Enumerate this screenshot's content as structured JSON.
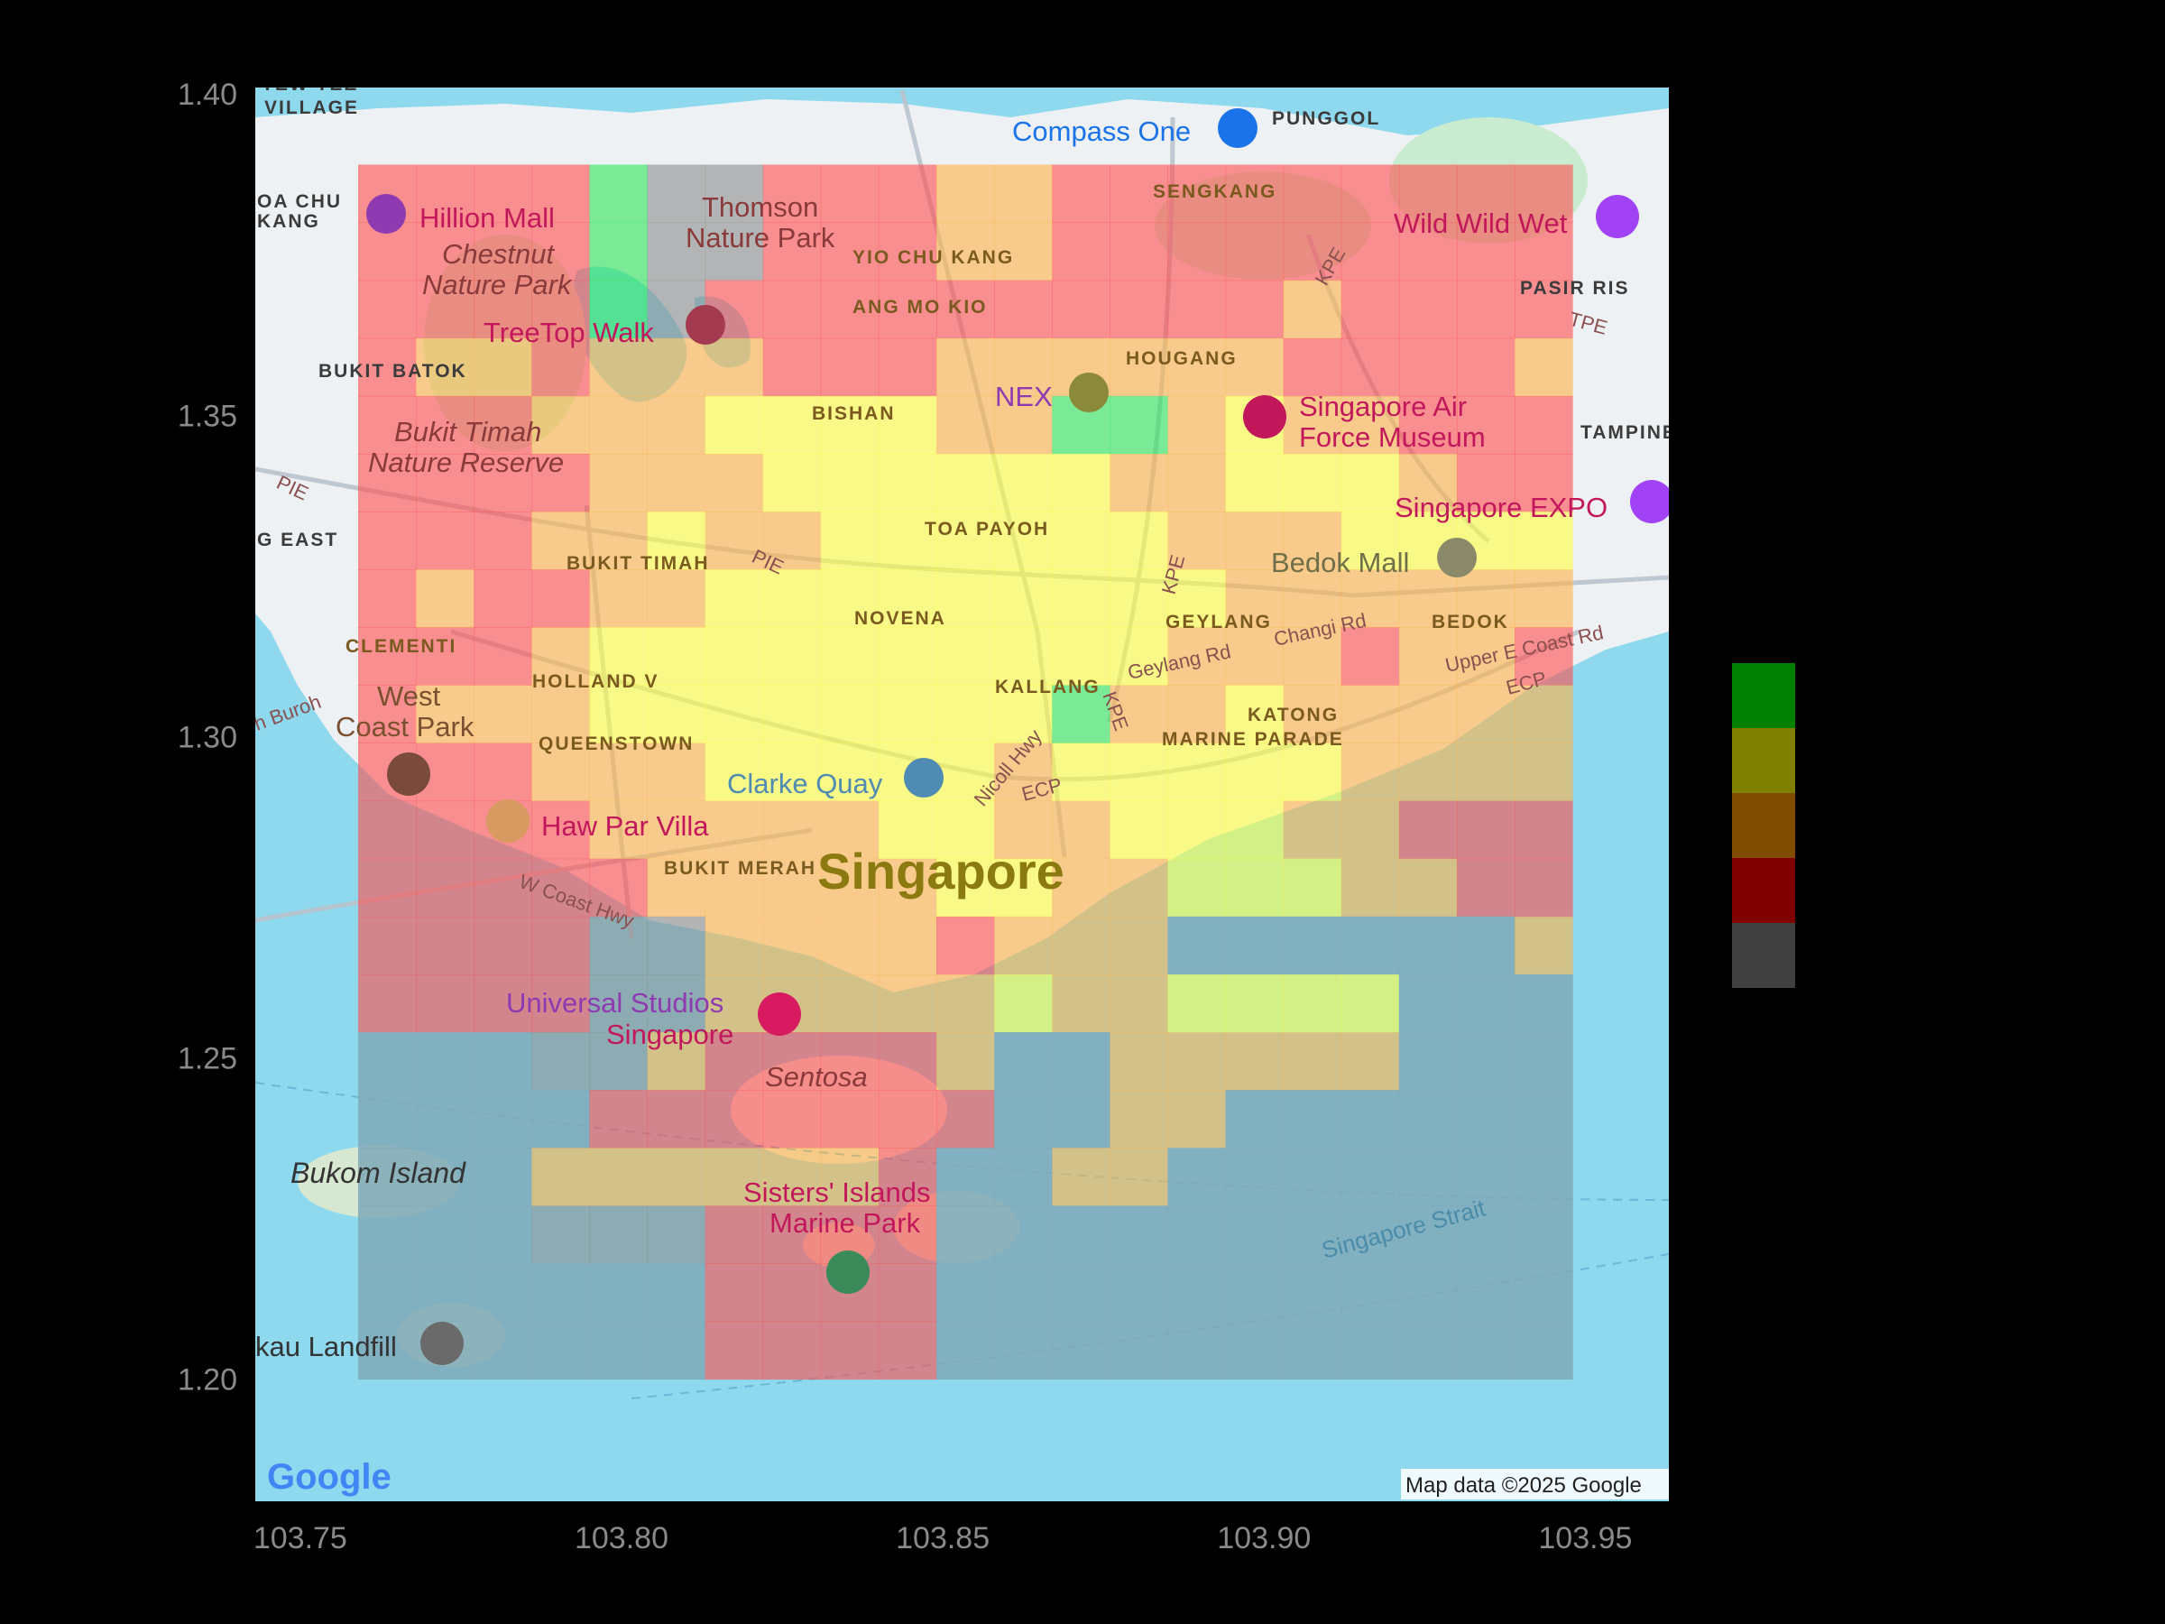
{
  "chart_data": {
    "type": "heatmap",
    "x_ticks": [
      "103.75",
      "103.80",
      "103.85",
      "103.90",
      "103.95"
    ],
    "y_ticks": [
      "1.40",
      "1.35",
      "1.30",
      "1.25",
      "1.20"
    ],
    "xlim": [
      103.743,
      103.963
    ],
    "ylim": [
      1.181,
      1.401
    ],
    "grid": {
      "lon_min": 103.759,
      "lat_min": 1.2,
      "cell_lon": 0.009,
      "cell_lat": 0.009,
      "cols": 21,
      "rows": 21
    },
    "legend": {
      "placement": "right",
      "colors": [
        "#008000",
        "#808000",
        "#804C00",
        "#800000",
        "#404040"
      ]
    },
    "cell_colors": {
      "g": "#2ee65a",
      "y": "#ffff40",
      "o": "#ffb347",
      "r": "#ff4d4d",
      "s": "#8c8c8c",
      "w": "#7fa8b8"
    },
    "cells": [
      "rrrrgssrrroorrrrrrrrr",
      "rrrrgssrrroorrrrrrrrr",
      "rrrrgsrrrrrrrrrrorrrr",
      "roorooorrroooooorrrro",
      "rrroooyyyyooggoyoorrr",
      "rrrroooyyyyyyooyyyorr",
      "rrrooyooyyyyyyoooyyyy",
      "rorrooyyyyyyyyyoooooo",
      "rrroyyyyyyyyyyoooroor",
      "roooyyyyyyyygooyooooo",
      "rrroooyyyyyoyyyyyoooo",
      "rrrroooooyyooyyyoorrr",
      "rrrrroooooyyooyyyoorr",
      "rrrrssoooorooorrrrrro",
      "rrrrssoooooyooyyyyrrr",
      "rrrssorrrrorrooooorrr",
      "rrrrrrrrrrrrroorrrrrr",
      "rrroooooorrroorrrrrrr",
      "rrrsssrrrrrrrrrrrrrrr",
      "rrrrrrrrrrrrrrrrrrrrr",
      "rrrrrrrrrrrrrrrrrrrrr"
    ],
    "water_mask_note": "",
    "map_labels": {
      "districts": [
        "PUNGGOL",
        "SENGKANG",
        "YIO CHU KANG",
        "ANG MO KIO",
        "HOUGANG",
        "PASIR RIS",
        "TAMPINES",
        "BUKIT BATOK",
        "BISHAN",
        "TOA PAYOH",
        "BUKIT TIMAH",
        "NOVENA",
        "GEYLANG",
        "BEDOK",
        "CLEMENTI",
        "HOLLAND V",
        "KALLANG",
        "KATONG",
        "MARINE PARADE",
        "QUEENSTOWN",
        "BUKIT MERAH",
        "TEW TEE",
        "VILLAGE",
        "OA CHU",
        "KANG",
        "G EAST"
      ],
      "pois": [
        "Compass One",
        "Hillion Mall",
        "Thomson",
        "Nature Park",
        "Wild Wild Wet",
        "TreeTop Walk",
        "NEX",
        "Singapore Air",
        "Force Museum",
        "Singapore EXPO",
        "Bedok Mall",
        "Clarke Quay",
        "Haw Par Villa",
        "Universal Studios",
        "Singapore",
        "Sisters' Islands",
        "Marine Park",
        "kau Landfill",
        "West",
        "Coast Park"
      ],
      "parks": [
        "Chestnut",
        "Nature Park",
        "Bukit Timah",
        "Nature Reserve",
        "Sentosa"
      ],
      "roads": [
        "PIE",
        "KPE",
        "TPE",
        "ECP",
        "Changi Rd",
        "Geylang Rd",
        "Upper E Coast Rd",
        "Nicoll Hwy",
        "W Coast Hwy",
        "h Buroh"
      ],
      "city": "Singapore",
      "islands": [
        "Bukom Island"
      ],
      "water": [
        "Singapore Strait"
      ]
    },
    "attribution": "Map data ©2025 Google",
    "logo": "Google"
  }
}
